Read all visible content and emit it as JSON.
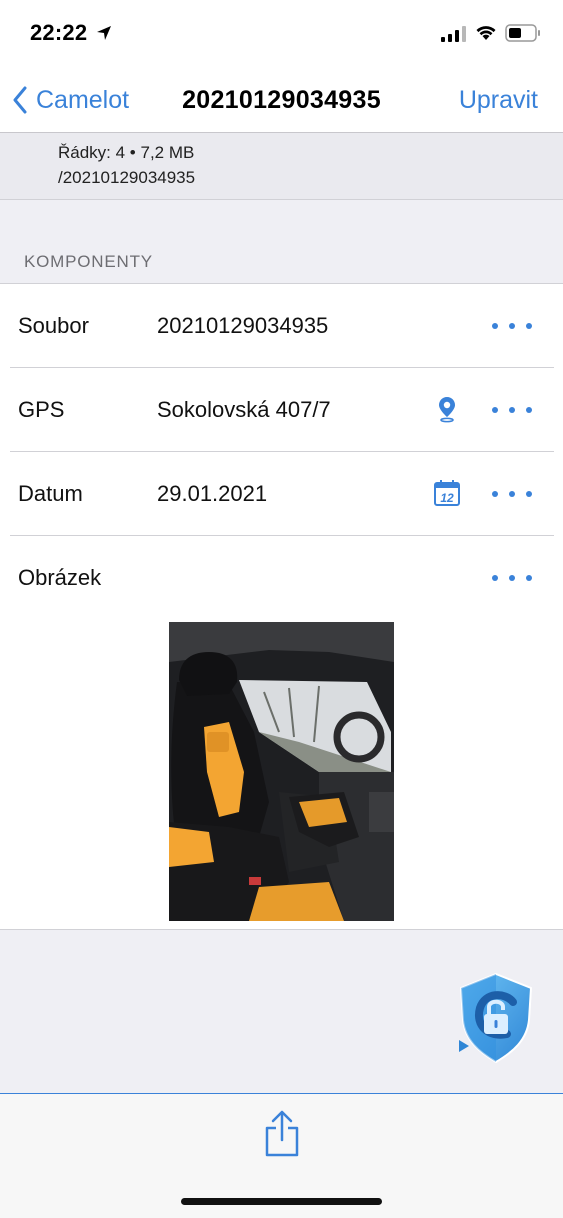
{
  "status_bar": {
    "time": "22:22"
  },
  "nav": {
    "back_label": "Camelot",
    "title": "20210129034935",
    "edit_label": "Upravit"
  },
  "info": {
    "line1": "Řádky: 4 • 7,2 MB",
    "line2": "/20210129034935"
  },
  "section": {
    "header": "KOMPONENTY"
  },
  "rows": [
    {
      "label": "Soubor",
      "value": "20210129034935",
      "aux_icon": "",
      "more_icon": "more-icon"
    },
    {
      "label": "GPS",
      "value": "Sokolovská 407/7",
      "aux_icon": "location-pin-icon",
      "more_icon": "more-icon"
    },
    {
      "label": "Datum",
      "value": "29.01.2021",
      "aux_icon": "calendar-icon",
      "calendar_day": "12",
      "more_icon": "more-icon"
    },
    {
      "label": "Obrázek",
      "value": "",
      "aux_icon": "",
      "more_icon": "more-icon"
    }
  ],
  "colors": {
    "accent": "#3a82d9",
    "background": "#efeff4",
    "separator": "#d1d1d6",
    "badge": "#3aa3e8"
  },
  "toolbar": {
    "share_icon": "share-icon"
  },
  "overlay": {
    "lock_icon": "lock-shield-icon"
  }
}
